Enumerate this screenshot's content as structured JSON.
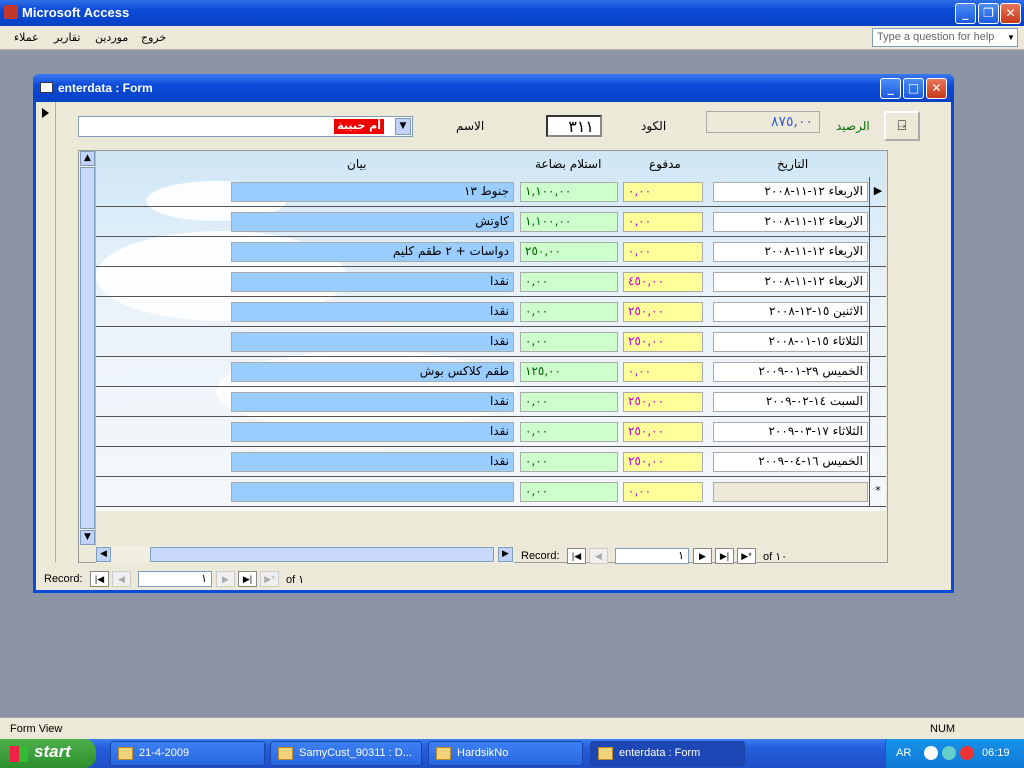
{
  "app": {
    "title": "Microsoft Access"
  },
  "menu": [
    "خروج",
    "موردين",
    "تقارير",
    "عملاء"
  ],
  "help_placeholder": "Type a question for help",
  "form": {
    "title": "enterdata : Form",
    "label_name": "الاسم",
    "name_value": "أم حبيبة",
    "label_code": "الكود",
    "code_value": "٣١١",
    "label_balance": "الرصيد",
    "balance_value": "٨٧٥,٠٠"
  },
  "grid": {
    "headers": {
      "date": "التاريخ",
      "paid": "مدفوع",
      "received": "استلام بضاعة",
      "desc": "بيان"
    },
    "rows": [
      {
        "date": "الاربعاء ١٢-١١-٢٠٠٨",
        "paid": "٠,٠٠",
        "received": "١,١٠٠,٠٠",
        "desc": "جنوط ١٣"
      },
      {
        "date": "الاربعاء ١٢-١١-٢٠٠٨",
        "paid": "٠,٠٠",
        "received": "١,١٠٠,٠٠",
        "desc": "كاوتش"
      },
      {
        "date": "الاربعاء ١٢-١١-٢٠٠٨",
        "paid": "٠,٠٠",
        "received": "٢٥٠,٠٠",
        "desc": "دواسات + ٢ طقم كليم"
      },
      {
        "date": "الاربعاء ١٢-١١-٢٠٠٨",
        "paid": "٤٥٠,٠٠",
        "received": "٠,٠٠",
        "desc": "نقدا"
      },
      {
        "date": "الاثنين ١٥-١٢-٢٠٠٨",
        "paid": "٢٥٠,٠٠",
        "received": "٠,٠٠",
        "desc": "نقدا"
      },
      {
        "date": "الثلاثاء ١٥-٠١-٢٠٠٨",
        "paid": "٢٥٠,٠٠",
        "received": "٠,٠٠",
        "desc": "نقدا"
      },
      {
        "date": "الخميس ٢٩-٠١-٢٠٠٩",
        "paid": "٠,٠٠",
        "received": "١٢٥,٠٠",
        "desc": "طقم كلاكس بوش"
      },
      {
        "date": "السبت ١٤-٠٢-٢٠٠٩",
        "paid": "٢٥٠,٠٠",
        "received": "٠,٠٠",
        "desc": "نقدا"
      },
      {
        "date": "الثلاثاء ١٧-٠٣-٢٠٠٩",
        "paid": "٢٥٠,٠٠",
        "received": "٠,٠٠",
        "desc": "نقدا"
      },
      {
        "date": "الخميس ١٦-٠٤-٢٠٠٩",
        "paid": "٢٥٠,٠٠",
        "received": "٠,٠٠",
        "desc": "نقدا"
      }
    ],
    "new_row": {
      "paid": "٠,٠٠",
      "received": "٠,٠٠"
    },
    "new_row_marker": "*",
    "selected_row_marker": "▶"
  },
  "sub_nav": {
    "label": "Record:",
    "current": "١",
    "of_label": "of ١٠"
  },
  "main_nav": {
    "label": "Record:",
    "current": "١",
    "of_label": "of ١"
  },
  "status": {
    "left": "Form View",
    "right": "NUM"
  },
  "taskbar": {
    "start": "start",
    "tasks": [
      "21-4-2009",
      "SamyCust_90311 : D...",
      "HardsikNo",
      "enterdata : Form"
    ],
    "lang": "AR",
    "clock": "06:19"
  }
}
